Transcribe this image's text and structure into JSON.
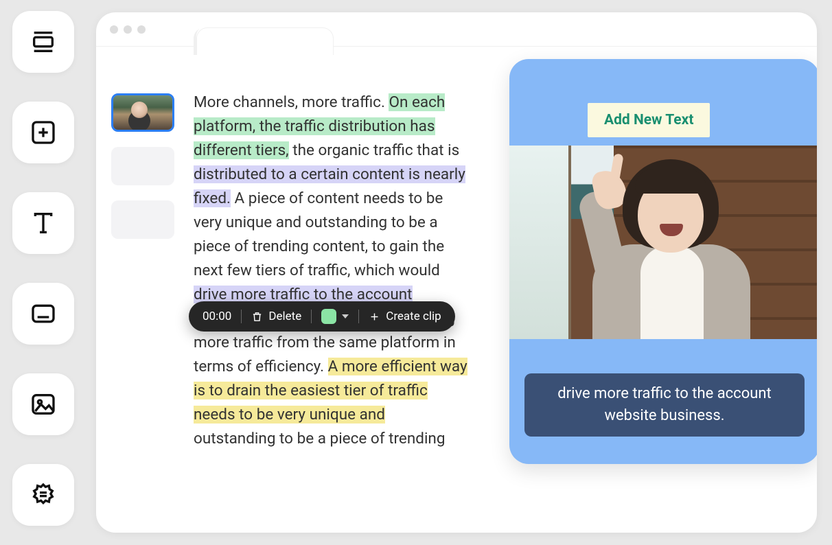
{
  "sidebar": {
    "tools": [
      {
        "name": "layout-icon"
      },
      {
        "name": "add-icon"
      },
      {
        "name": "text-icon"
      },
      {
        "name": "subtitle-icon"
      },
      {
        "name": "image-icon"
      },
      {
        "name": "badge-icon"
      }
    ]
  },
  "transcript": {
    "segments": [
      {
        "text": "More channels, more traffic. ",
        "highlight": null
      },
      {
        "text": "On each platform, the traffic distribution has different tiers,",
        "highlight": "green"
      },
      {
        "text": " the organic traffic that is ",
        "highlight": null
      },
      {
        "text": "distributed to a certain content is nearly fixed.",
        "highlight": "purple"
      },
      {
        "text": " A piece of content needs to be very unique and outstanding to be a piece of trending content, to gain the next few tiers of traffic, which would ",
        "highlight": null
      },
      {
        "text": "drive more traffic to the account website business.",
        "highlight": "purple"
      },
      {
        "text": " Therefore, it is a dig more traffic from the same platform in terms of efficiency. ",
        "highlight": null
      },
      {
        "text": "A more efficient way is to drain the easiest tier of traffic needs to be very unique and",
        "highlight": "yellow"
      },
      {
        "text": " outstanding to be a piece of trending",
        "highlight": null
      }
    ]
  },
  "toolbar": {
    "timestamp": "00:00",
    "delete_label": "Delete",
    "highlight_color": "#8be4a5",
    "create_clip_label": "Create clip"
  },
  "preview": {
    "add_text_label": "Add New Text",
    "caption_line1": "drive more traffic to the account",
    "caption_line2": "website business."
  }
}
